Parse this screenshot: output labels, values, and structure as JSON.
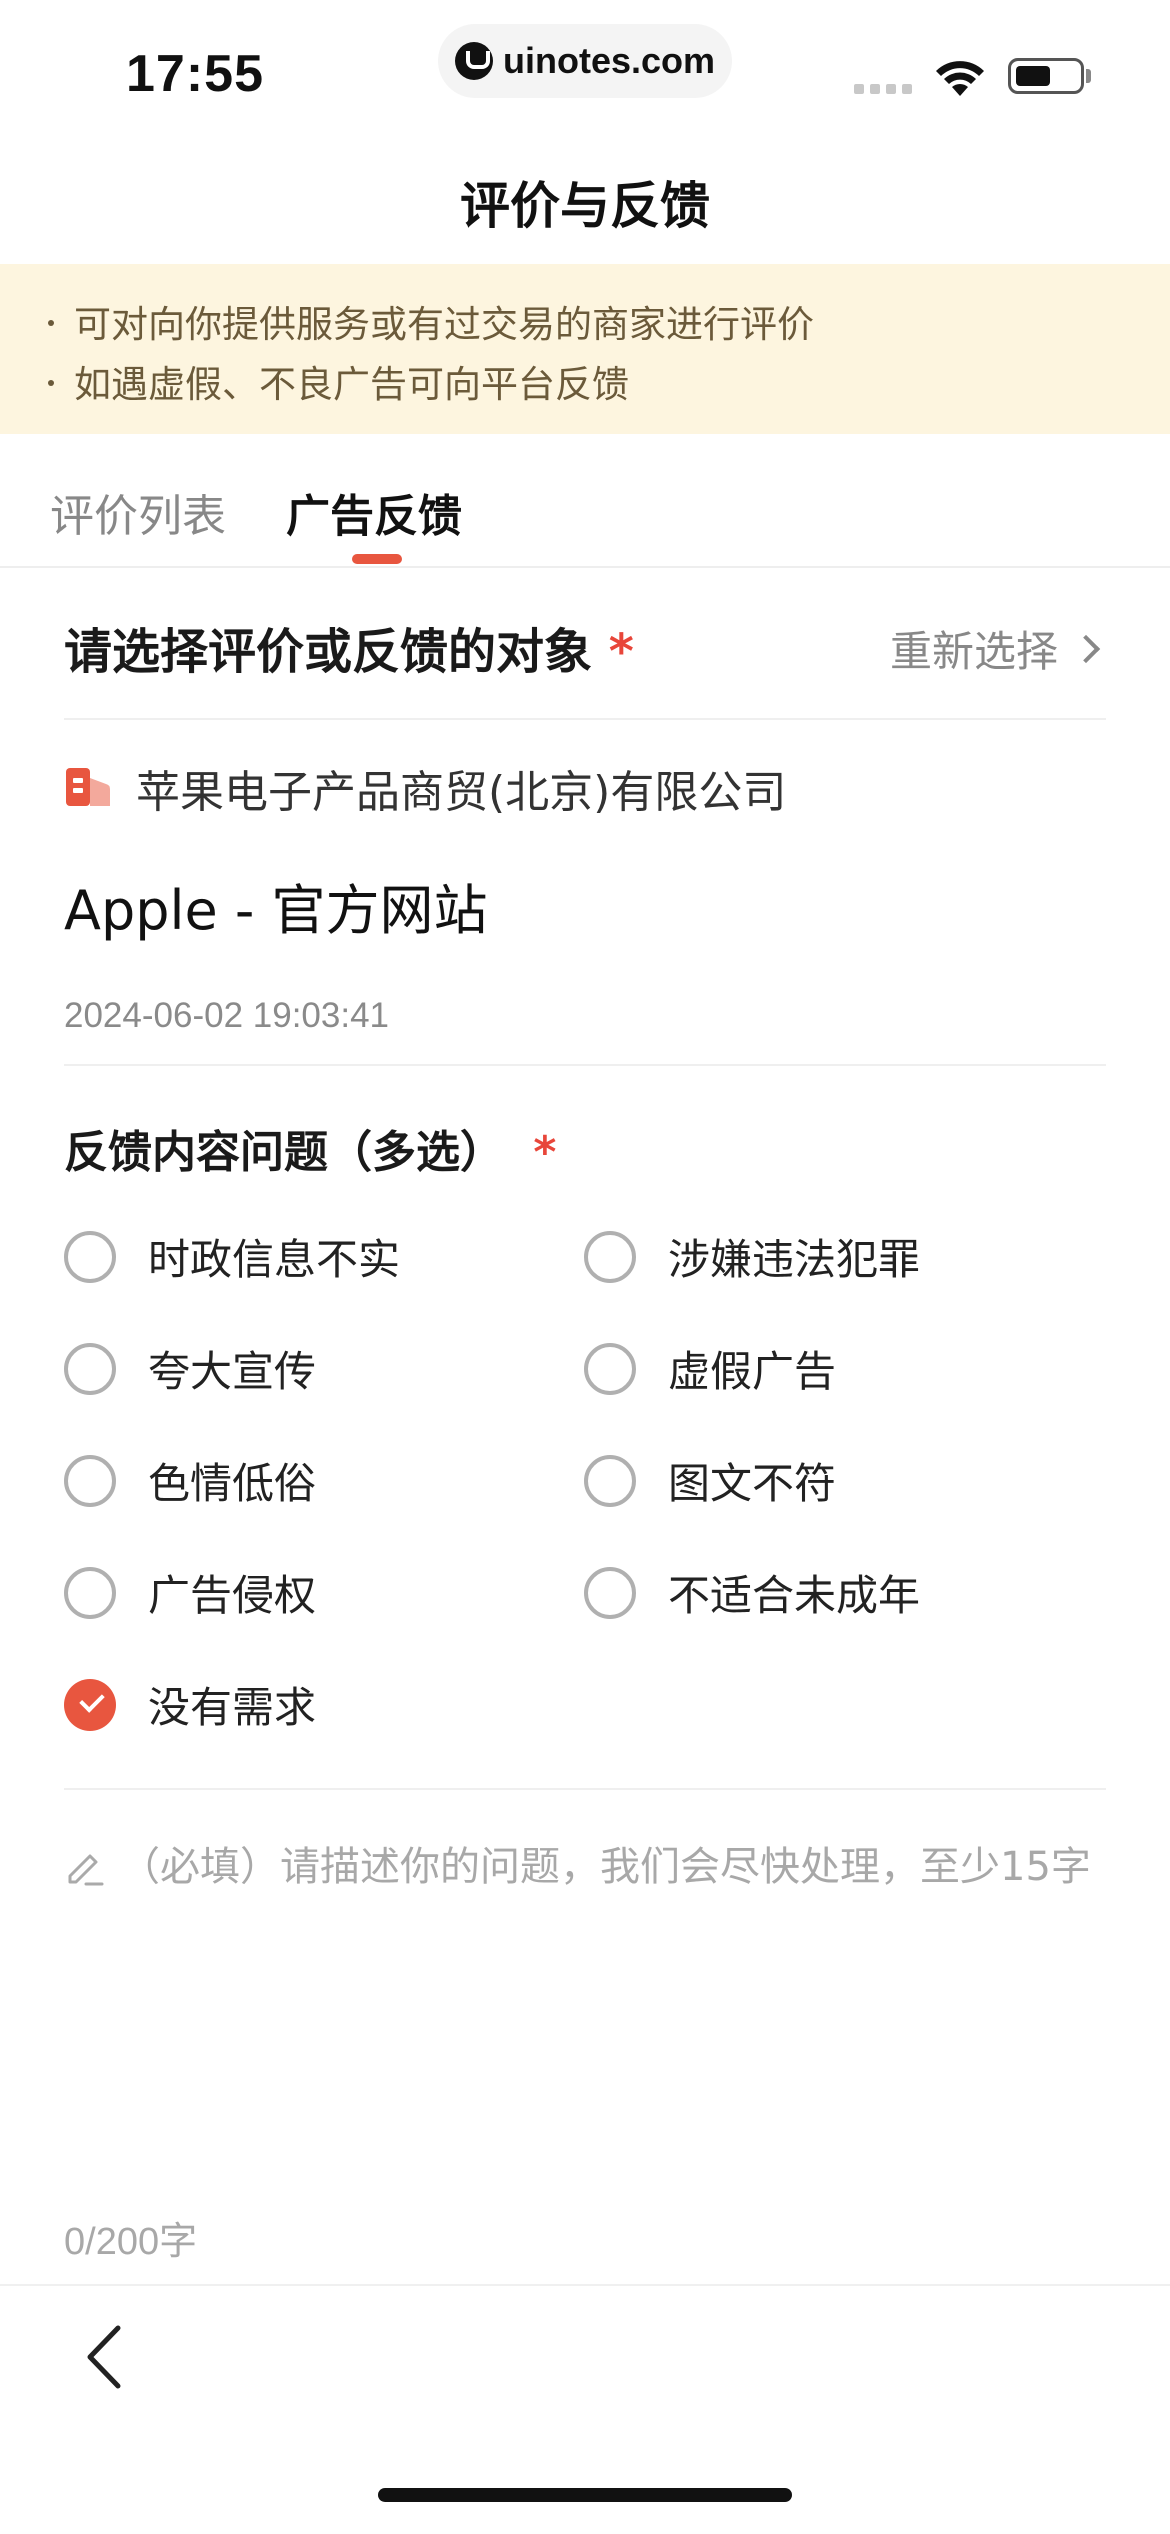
{
  "status_bar": {
    "time": "17:55",
    "url": "uinotes.com"
  },
  "nav": {
    "title": "评价与反馈"
  },
  "notice": {
    "lines": [
      "可对向你提供服务或有过交易的商家进行评价",
      "如遇虚假、不良广告可向平台反馈"
    ]
  },
  "tabs": [
    {
      "label": "评价列表",
      "active": false
    },
    {
      "label": "广告反馈",
      "active": true
    }
  ],
  "target": {
    "title": "请选择评价或反馈的对象",
    "required_mark": "*",
    "reselect_label": "重新选择",
    "company": "苹果电子产品商贸(北京)有限公司",
    "site_title": "Apple - 官方网站",
    "datetime": "2024-06-02 19:03:41"
  },
  "feedback": {
    "title": "反馈内容问题（多选）",
    "required_mark": "*",
    "options": [
      {
        "label": "时政信息不实",
        "checked": false
      },
      {
        "label": "涉嫌违法犯罪",
        "checked": false
      },
      {
        "label": "夸大宣传",
        "checked": false
      },
      {
        "label": "虚假广告",
        "checked": false
      },
      {
        "label": "色情低俗",
        "checked": false
      },
      {
        "label": "图文不符",
        "checked": false
      },
      {
        "label": "广告侵权",
        "checked": false
      },
      {
        "label": "不适合未成年",
        "checked": false
      },
      {
        "label": "没有需求",
        "checked": true
      }
    ]
  },
  "description": {
    "placeholder": "（必填）请描述你的问题，我们会尽快处理，至少15字",
    "counter": "0/200字"
  },
  "colors": {
    "accent": "#e8563f",
    "required": "#e8463a",
    "notice_bg": "#fdf5df",
    "notice_text": "#6b5a3a"
  },
  "icons": {
    "back": "chevron-left-icon",
    "reselect": "chevron-right-icon",
    "company": "building-icon",
    "pencil": "pencil-icon"
  }
}
